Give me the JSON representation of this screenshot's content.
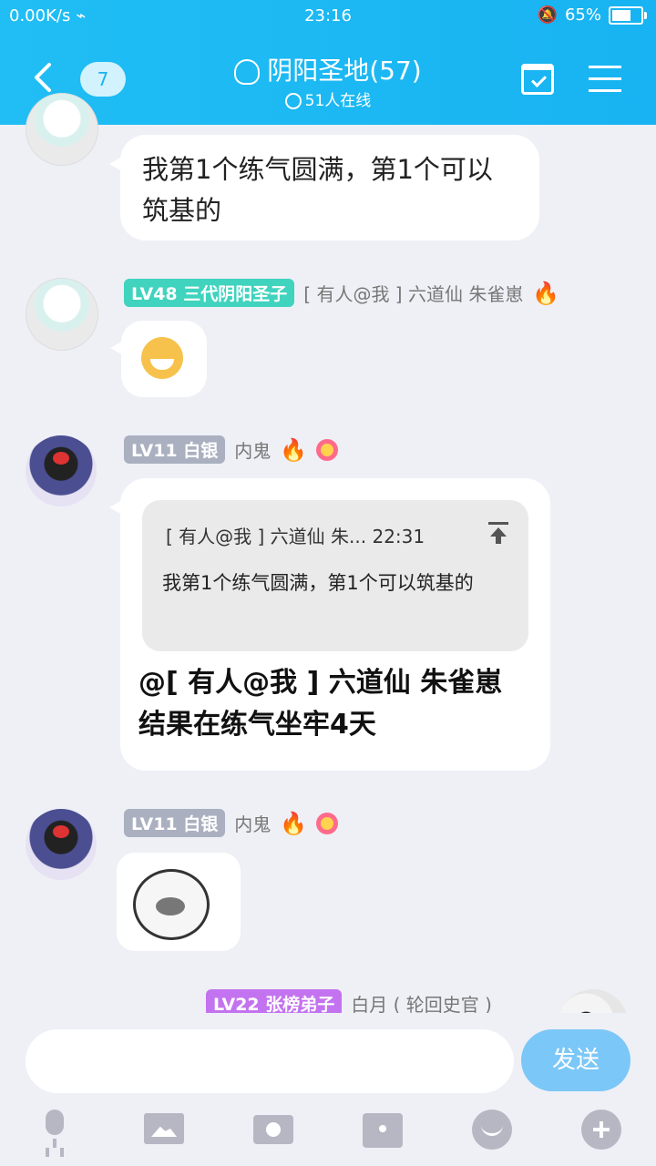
{
  "statusbar": {
    "network": "0.00K/s",
    "time": "23:16",
    "battery": "65%"
  },
  "header": {
    "badge": "7",
    "title": "阴阳圣地(57)",
    "subtitle": "51人在线"
  },
  "messages": {
    "m1": {
      "text": "我第1个练气圆满，第1个可以筑基的"
    },
    "m2": {
      "level": "LV48",
      "title": "三代阴阳圣子",
      "name": "[ 有人@我 ] 六道仙 朱雀崽"
    },
    "m3": {
      "level": "LV11",
      "title": "白银",
      "name": "内鬼",
      "quote_header": "[ 有人@我 ] 六道仙 朱... 22:31",
      "quote_body": "我第1个练气圆满，第1个可以筑基的",
      "text": "@[ 有人@我 ] 六道仙 朱雀崽 结果在练气坐牢4天"
    },
    "m4": {
      "level": "LV11",
      "title": "白银",
      "name": "内鬼"
    },
    "m5": {
      "level": "LV22",
      "title": "张榜弟子",
      "name": "白月 ( 轮回史官 )"
    }
  },
  "composer": {
    "send_label": "发送",
    "placeholder": ""
  },
  "icons": {
    "back": "chevron-left-icon",
    "calendar": "calendar-check-icon",
    "menu": "hamburger-menu-icon",
    "mic": "microphone-icon",
    "image": "image-icon",
    "camera": "camera-icon",
    "wallet": "red-packet-icon",
    "emoji": "emoji-icon",
    "plus": "plus-icon"
  },
  "colors": {
    "header": "#1fb8f3",
    "level_teal": "#40d3be",
    "level_gray": "#aab0c0",
    "level_purple": "#c373ef",
    "send": "#7bc7f7"
  }
}
